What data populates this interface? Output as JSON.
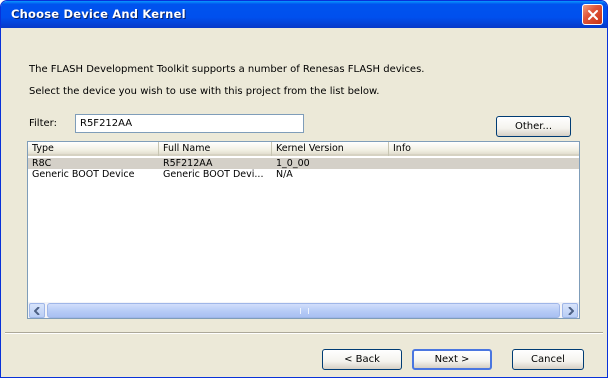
{
  "window": {
    "title": "Choose Device And Kernel"
  },
  "description": {
    "line1": "The FLASH Development Toolkit supports a number of Renesas FLASH devices.",
    "line2": "Select the device you wish to use with this project from the list below."
  },
  "filter": {
    "label": "Filter:",
    "value": "R5F212AA"
  },
  "other_button": {
    "label": "Other..."
  },
  "device_list": {
    "columns": [
      "Type",
      "Full Name",
      "Kernel Version",
      "Info"
    ],
    "rows": [
      {
        "type": "R8C",
        "full_name": "R5F212AA",
        "kernel_version": "1_0_00",
        "info": "",
        "selected": true
      },
      {
        "type": "Generic BOOT Device",
        "full_name": "Generic BOOT Devi...",
        "kernel_version": "N/A",
        "info": "",
        "selected": false
      }
    ]
  },
  "footer": {
    "back_label": "< Back",
    "next_label": "Next >",
    "cancel_label": "Cancel"
  },
  "icons": {
    "close": "close-icon",
    "scroll_left": "arrow-left-icon",
    "scroll_right": "arrow-right-icon"
  },
  "colors": {
    "titlebar": "#0053ee",
    "window_bg": "#ece9d8",
    "close_button": "#e0563a",
    "selected_row": "#d4d0c8"
  }
}
